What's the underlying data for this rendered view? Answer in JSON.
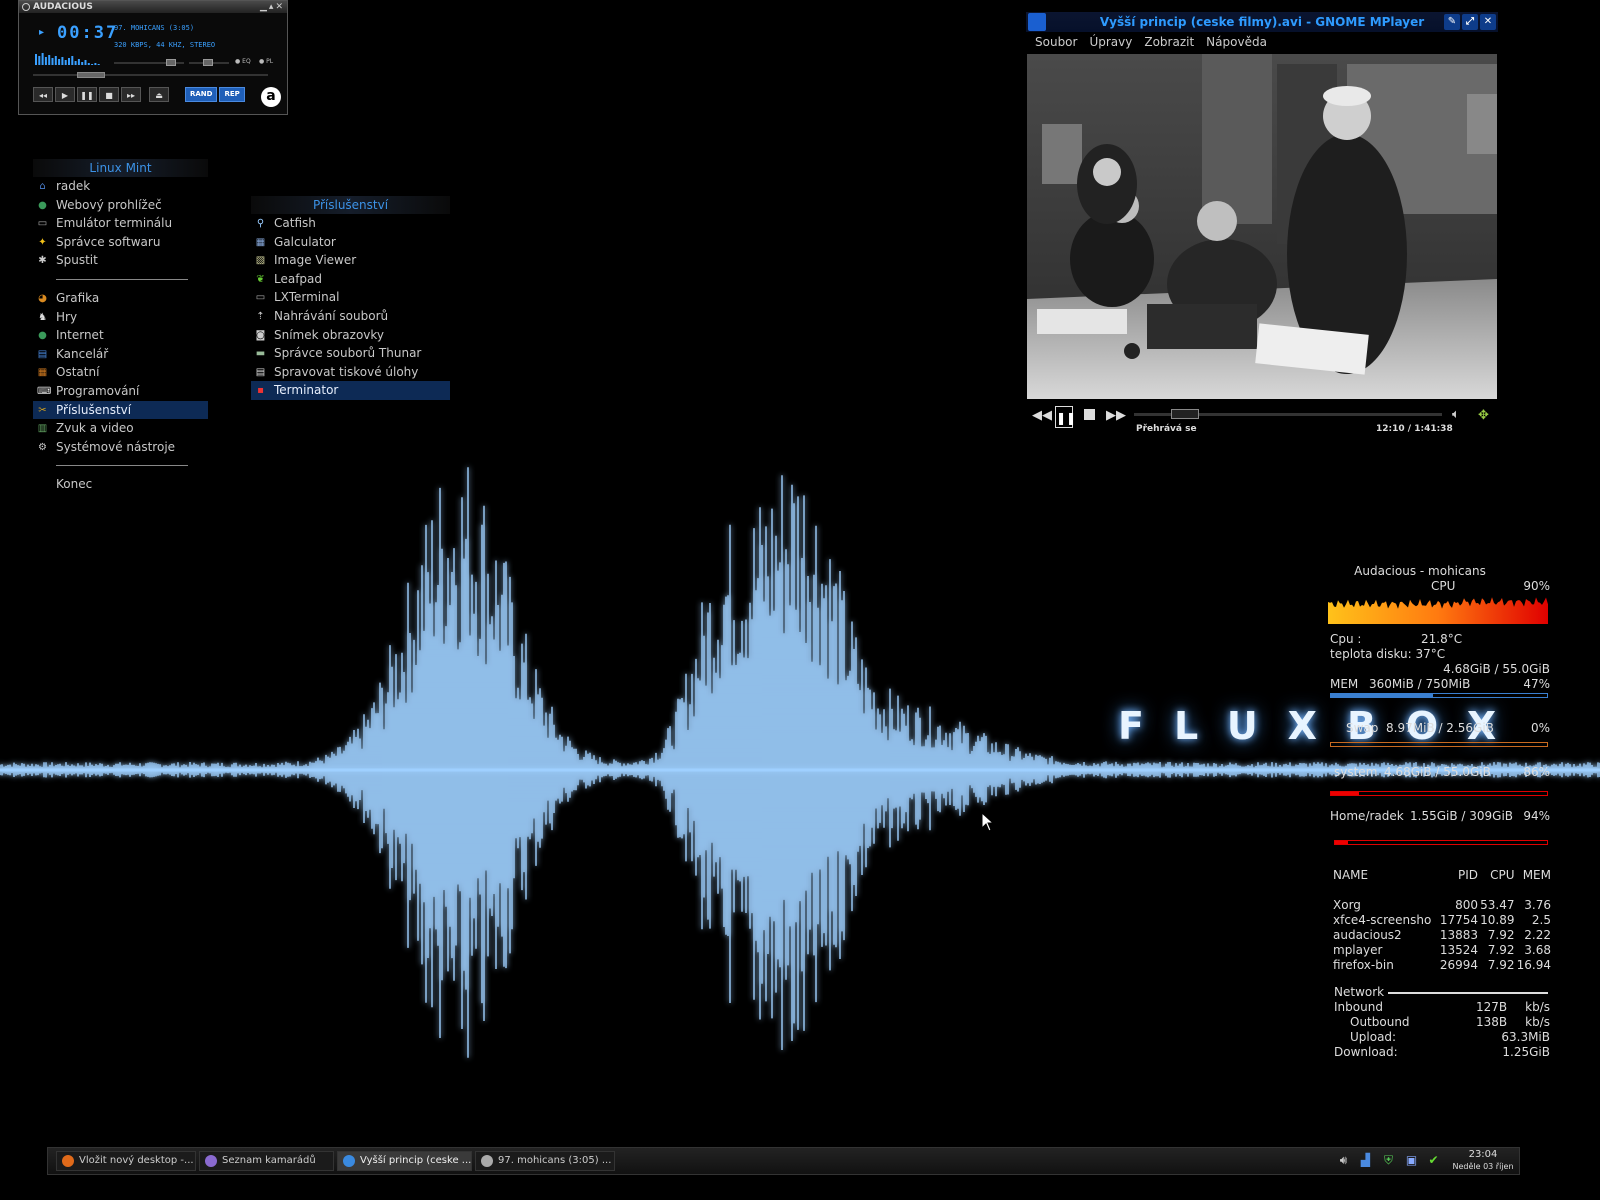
{
  "wallpaper": {
    "brand": "FLUXBOX"
  },
  "audacious": {
    "title": "AUDACIOUS",
    "time": "00:37",
    "track": "97. MOHICANS (3:05)",
    "stream_info": "320 KBPS, 44 KHZ, STEREO",
    "eq_label": "EQ",
    "pl_label": "PL",
    "rand_label": "RAND",
    "rep_label": "REP",
    "logo": "a",
    "accent": "#3aa0ff"
  },
  "main_menu": {
    "header": "Linux Mint",
    "items_top": [
      {
        "label": "radek",
        "icon": "home-icon"
      },
      {
        "label": "Webový prohlížeč",
        "icon": "globe-icon"
      },
      {
        "label": "Emulátor terminálu",
        "icon": "terminal-icon"
      },
      {
        "label": "Správce softwaru",
        "icon": "star-icon"
      },
      {
        "label": "Spustit",
        "icon": "run-icon"
      }
    ],
    "items_categories": [
      {
        "label": "Grafika",
        "icon": "palette-icon"
      },
      {
        "label": "Hry",
        "icon": "game-icon"
      },
      {
        "label": "Internet",
        "icon": "globe-icon"
      },
      {
        "label": "Kancelář",
        "icon": "office-icon"
      },
      {
        "label": "Ostatní",
        "icon": "other-icon"
      },
      {
        "label": "Programování",
        "icon": "code-icon"
      },
      {
        "label": "Příslušenství",
        "icon": "accessories-icon",
        "selected": true
      },
      {
        "label": "Zvuk a video",
        "icon": "media-icon"
      },
      {
        "label": "Systémové nástroje",
        "icon": "gear-icon"
      }
    ],
    "exit": "Konec"
  },
  "sub_menu": {
    "header": "Příslušenství",
    "items": [
      {
        "label": "Catfish",
        "icon": "search-icon"
      },
      {
        "label": "Galculator",
        "icon": "calculator-icon"
      },
      {
        "label": "Image Viewer",
        "icon": "image-icon"
      },
      {
        "label": "Leafpad",
        "icon": "leaf-icon"
      },
      {
        "label": "LXTerminal",
        "icon": "terminal-icon"
      },
      {
        "label": "Nahrávání souborů",
        "icon": "upload-icon"
      },
      {
        "label": "Snímek obrazovky",
        "icon": "camera-icon"
      },
      {
        "label": "Správce souborů Thunar",
        "icon": "folder-icon"
      },
      {
        "label": "Spravovat tiskové úlohy",
        "icon": "printer-icon"
      },
      {
        "label": "Terminator",
        "icon": "terminator-icon",
        "selected": true
      }
    ]
  },
  "mplayer": {
    "title": "Vyšší princip (ceske filmy).avi - GNOME MPlayer",
    "menu": [
      "Soubor",
      "Úpravy",
      "Zobrazit",
      "Nápověda"
    ],
    "status": "Přehrává se",
    "time": "12:10 / 1:41:38",
    "progress": 0.12
  },
  "conky": {
    "title": "Audacious - mohicans",
    "cpu_label": "CPU",
    "cpu_pct": "90%",
    "cpu_temp_label": "Cpu :",
    "cpu_temp": "21.8°C",
    "disk_temp": "teplota disku: 37°C",
    "disk_total": "4.68GiB / 55.0GiB",
    "mem_label": "MEM",
    "mem_value": "360MiB / 750MiB",
    "mem_pct": "47%",
    "mem_fill": 0.47,
    "swap_label": "Swap",
    "swap_value": "8.97MiB / 2.56GiB",
    "swap_pct": "0%",
    "swap_fill": 0.0,
    "system_label": "system",
    "system_value": "4.68GiB / 55.0GiB",
    "system_pct": "86%",
    "system_fill": 0.13,
    "home_label": "Home/radek",
    "home_value": "1.55GiB / 309GiB",
    "home_pct": "94%",
    "home_fill": 0.06,
    "proc_header": [
      "NAME",
      "PID",
      "CPU",
      "MEM"
    ],
    "processes": [
      [
        "Xorg",
        "800",
        "53.47",
        "3.76"
      ],
      [
        "xfce4-screensho",
        "17754",
        "10.89",
        "2.5"
      ],
      [
        "audacious2",
        "13883",
        "7.92",
        "2.22"
      ],
      [
        "mplayer",
        "13524",
        "7.92",
        "3.68"
      ],
      [
        "firefox-bin",
        "26994",
        "7.92",
        "16.94"
      ]
    ],
    "network_label": "Network",
    "inbound_label": "Inbound",
    "inbound_value": "127B",
    "inbound_unit": "kb/s",
    "outbound_label": "Outbound",
    "outbound_value": "138B",
    "outbound_unit": "kb/s",
    "upload_label": "Upload:",
    "upload_value": "63.3MiB",
    "download_label": "Download:",
    "download_value": "1.25GiB"
  },
  "taskbar": {
    "tasks": [
      {
        "label": "Vložit nový desktop -...",
        "icon": "firefox-icon",
        "color": "#e06a1a"
      },
      {
        "label": "Seznam kamarádů",
        "icon": "pidgin-icon",
        "color": "#8a6ad0"
      },
      {
        "label": "Vyšší princip (ceske ...",
        "icon": "mplayer-icon",
        "color": "#3a8ae0",
        "active": true
      },
      {
        "label": "97. mohicans (3:05) ...",
        "icon": "audacious-icon",
        "color": "#aaaaaa"
      }
    ],
    "clock_time": "23:04",
    "clock_date": "Neděle 03 říjen"
  }
}
